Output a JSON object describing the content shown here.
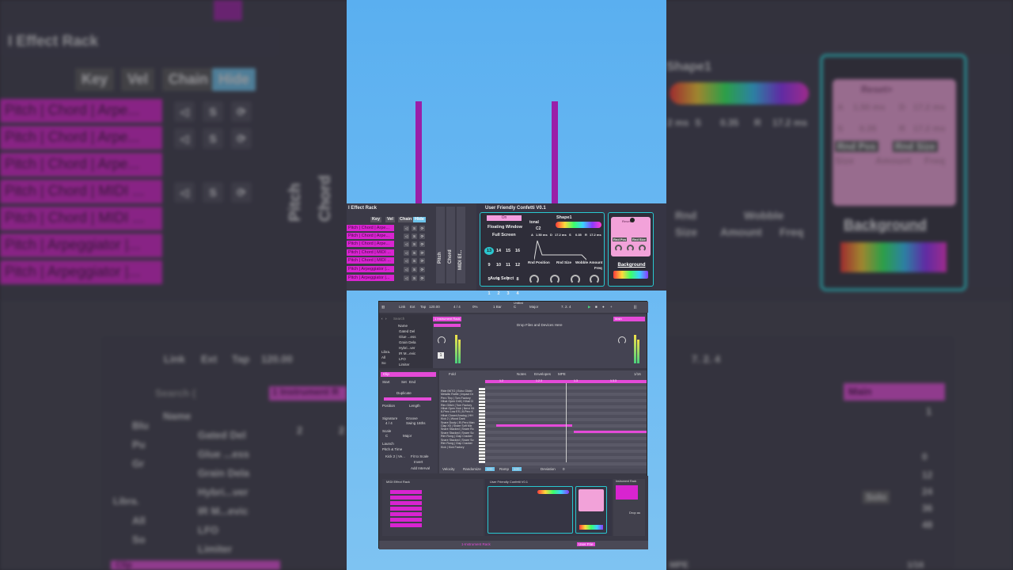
{
  "background": {
    "rack_title": "I Effect Rack",
    "chips": [
      "Key",
      "Vel",
      "Chain",
      "Hide"
    ],
    "chain_rows": [
      "Pitch | Chord | Arpe...",
      "Pitch | Chord | Arpe...",
      "Pitch | Chord | Arpe...",
      "Pitch | Chord | MIDI ...",
      "Pitch | Chord | MIDI ...",
      "Pitch | Arpeggiator |...",
      "Pitch | Arpeggiator |..."
    ],
    "vertical_labels": [
      "Pitch",
      "Chord"
    ],
    "right_labels": {
      "shape": "Shape1",
      "reset": "Reset>",
      "ms1": "2 ms",
      "s": "S",
      "s_val": "0.35",
      "r": "R",
      "r_val": "17.2 ms",
      "a": "A",
      "a_val": "1.50 ms",
      "d": "D",
      "d_val": "17.2 ms",
      "s2": "S",
      "s2_val": "0.35",
      "r2": "R",
      "r2_val": "17.2 ms",
      "rnd_pos": "Rnd Pos",
      "rnd_size": "Rnd Size",
      "size": "Size",
      "amount": "Amount",
      "freq": "Freq",
      "rnd": "Rnd",
      "wobble": "Wobble",
      "size2": "Size",
      "amount2": "Amount",
      "freq2": "Freq",
      "background": "Background"
    },
    "transport": {
      "link": "Link",
      "ext": "Ext",
      "tap": "Tap",
      "bpm": "120.00",
      "position": "7. 2. 4"
    },
    "browser_search": "Search (",
    "browser_name": "Name",
    "browser_items": [
      "Gated Del",
      "Glue ...ess",
      "Grain Dela",
      "Hybri...ver",
      "IR M...evic",
      "LFO",
      "Limiter"
    ],
    "browser_side": [
      "Blu",
      "Pu",
      "Gr",
      "Libra.",
      "All",
      "So"
    ],
    "track_name": "1 Instrument R",
    "track_nums": [
      "2",
      "2"
    ],
    "main_label": "Main",
    "main_val": "1",
    "meter_nums": [
      "0",
      "12",
      "24",
      "36",
      "48"
    ],
    "solo": "Solo",
    "clip_label": "Clip",
    "mpe": "MPE",
    "page": "1/16"
  },
  "rack": {
    "title": "I Effect Rack",
    "tabs": [
      "Key",
      "Vel",
      "Chain",
      "Hide"
    ],
    "rows": [
      "Pitch | Chord | Arpe...",
      "Pitch | Chord | Arpe...",
      "Pitch | Chord | Arpe...",
      "Pitch | Chord | MIDI ...",
      "Pitch | Chord | MIDI ...",
      "Pitch | Arpeggiator |...",
      "Pitch | Arpeggiator |..."
    ],
    "vlabels": [
      "Pitch",
      "Chord",
      "MIDI Ef..."
    ]
  },
  "confetti": {
    "title": "User Friendly Confetti V0.1",
    "on": "On",
    "floating": "Floating Window",
    "fullscreen": "Full Screen",
    "auto_select": "Auto Select",
    "numbers": [
      "13",
      "14",
      "15",
      "16",
      "9",
      "10",
      "11",
      "12",
      "5",
      "6",
      "7",
      "8",
      "1",
      "2",
      "3",
      "4"
    ],
    "tonal": "tonal",
    "note": "C2",
    "shape": "Shape1",
    "env": [
      "A",
      "1.50 ms",
      "D",
      "17.2 ms",
      "S",
      "0.35",
      "R",
      "17.2 ms"
    ],
    "knobs": [
      "Rnd Position",
      "Rnd Size",
      "Wobble Amount",
      "Freq"
    ],
    "bg_labels": [
      "Reset>",
      "Rnd Pos",
      "Rnd Size"
    ],
    "background": "Background"
  },
  "daw": {
    "toolbar": [
      "Link",
      "Ext",
      "Tap",
      "120.00",
      "4 / 4",
      "0%",
      "1 Bar",
      "C",
      "Major",
      "7. 2. 4"
    ],
    "untitled": "Untitled",
    "search": "Search",
    "name": "Name",
    "browser": [
      "Gated Del",
      "Glue ...ess",
      "Grain Dela",
      "Hybri...ver",
      "IR M...evic",
      "LFO",
      "Limiter"
    ],
    "sidebar": [
      "Libra.",
      "All",
      "So"
    ],
    "track": "1 Instrument Rack",
    "drop": "Drop Files and Devices Here",
    "main": "Main",
    "clip_title": "Clip",
    "clip_rows": [
      "Start",
      "Set",
      "End",
      "Duplicate",
      "Position",
      "Length",
      "Signature",
      "Groove",
      "4 / 4",
      "Swing 16ths",
      "Scale",
      "C",
      "Major",
      "Launch",
      "Pitch & Time",
      "Kick 2 | Ve...",
      "Fit to Scale",
      "Invert",
      "Add Interval"
    ],
    "fold": "Fold",
    "tabs": [
      "Notes",
      "Envelopes",
      "MPE"
    ],
    "page": "1/16",
    "ruler": [
      "1.2",
      "1.2.3",
      "1.3",
      "1.3.3"
    ],
    "drum_names": [
      "Ride BKTG | Echo Glider",
      "Metallic Rattle | Impact Dr",
      "Perc Tiny | Tom Factory",
      "Hihat Open Drill | Hihat Cl",
      "Rim Glitch | Tom Factory",
      "Hihat Open Noir | Nervi Kit",
      "8-Perc Low ES | 8-Perc K",
      "Hihat Closed Analog | HH",
      "Kick 2 | Wood Dark",
      "Snare Dusty | El-Perc Man",
      "Clap X5 | Snare Soft Mix",
      "Snare Stacked | Snare Ro",
      "Snare Stacked | Snare So",
      "Rim Rung | Clap Cracker",
      "Snare Stacked | Snare So",
      "Rim Rung | Clap Cracker",
      "Kick | Kick Factory"
    ],
    "velocity": [
      "Velocity",
      "Randomize",
      "100",
      "Ramp",
      "100",
      "Deviation",
      "0"
    ],
    "bottom_rack": "MIDI Effect Rack",
    "bottom_confetti": "User Friendly Confetti V0.1",
    "bottom_right": "Instrument Rack",
    "drop_short": "Drop au",
    "status": [
      "1-Instrument Rack",
      "User Frie"
    ]
  }
}
